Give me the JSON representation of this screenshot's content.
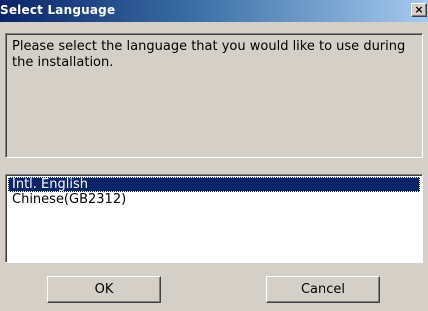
{
  "window": {
    "title": "Select Language",
    "close_glyph": "×",
    "close_icon": "close-icon"
  },
  "message": {
    "text": "Please select the language that you would like to use during the installation."
  },
  "languages": {
    "items": [
      {
        "label": "Intl. English",
        "selected": true
      },
      {
        "label": "Chinese(GB2312)",
        "selected": false
      }
    ]
  },
  "buttons": {
    "ok_label": "OK",
    "cancel_label": "Cancel"
  },
  "colors": {
    "dialog_face": "#d4d0c8",
    "titlebar_start": "#0a246a",
    "titlebar_end": "#a6caf0",
    "selection": "#0a246a",
    "list_background": "#ffffff"
  }
}
